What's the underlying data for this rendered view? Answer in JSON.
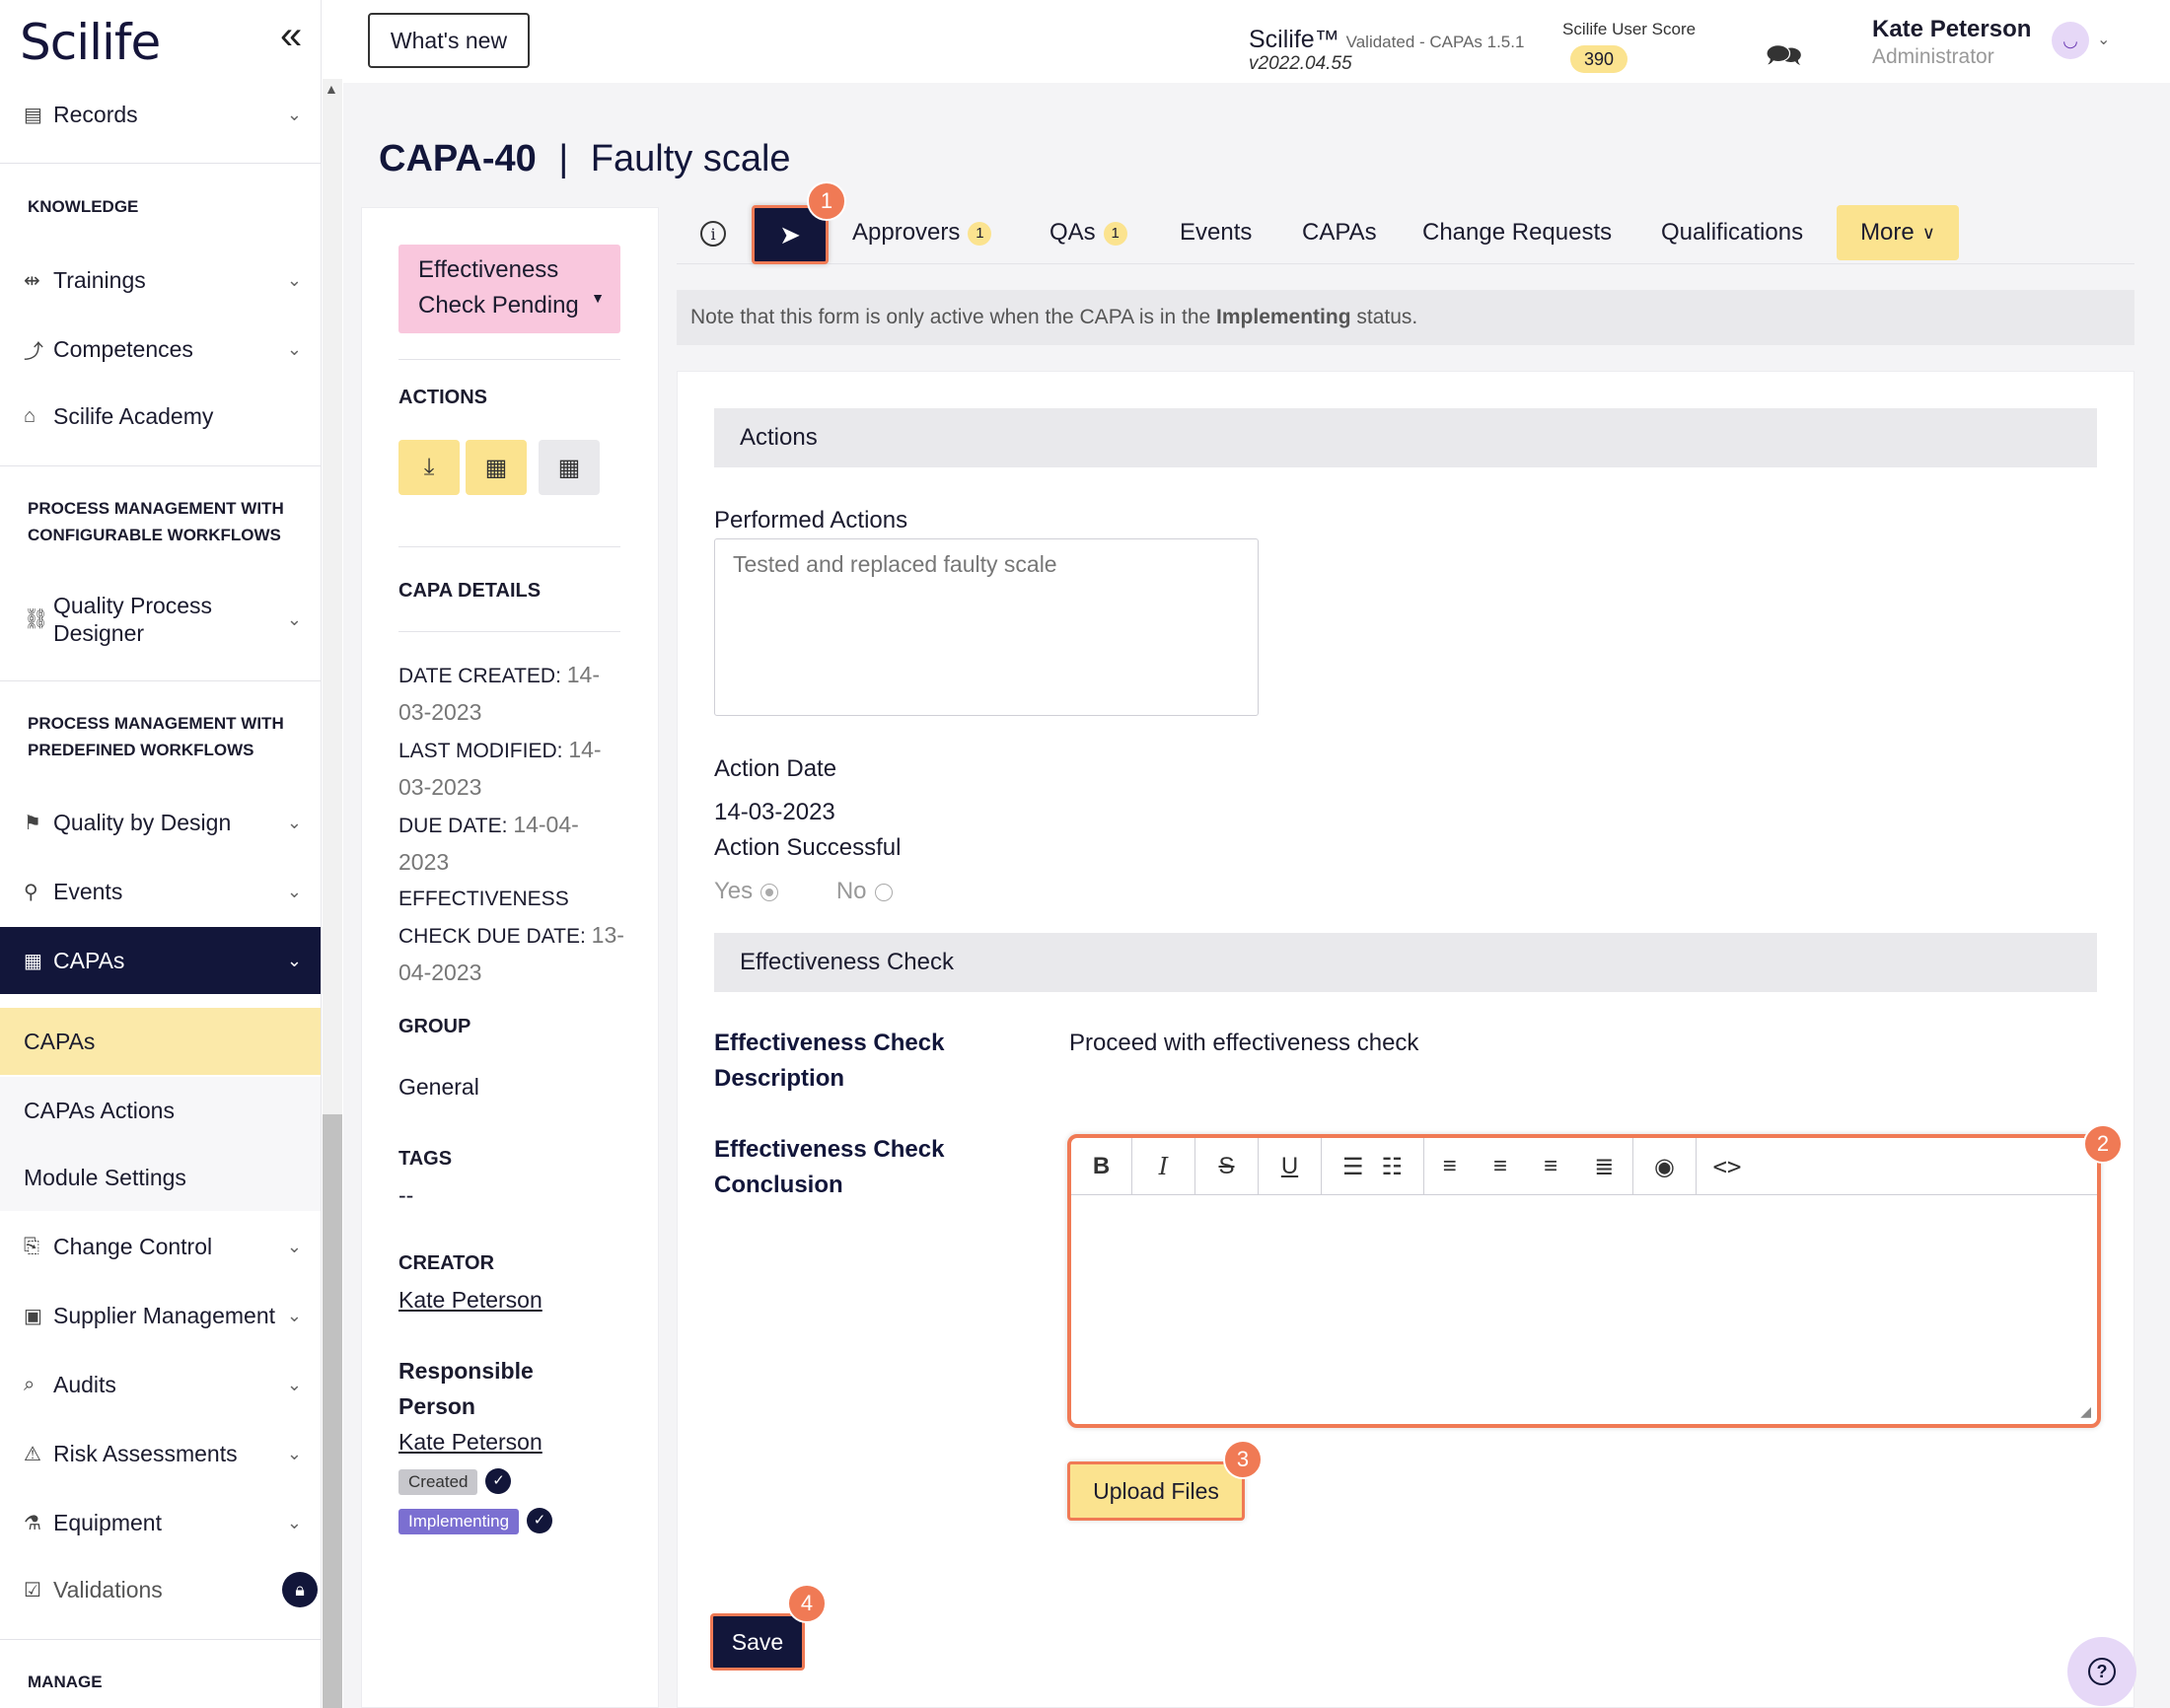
{
  "app": {
    "logo": "Scilife",
    "collapse_icon": "double-chevron-left-icon"
  },
  "sidebar": {
    "records": "Records",
    "knowledge_header": "KNOWLEDGE",
    "trainings": "Trainings",
    "competences": "Competences",
    "academy": "Scilife Academy",
    "pm_configurable_header_1": "PROCESS MANAGEMENT WITH",
    "pm_configurable_header_2": "CONFIGURABLE WORKFLOWS",
    "qpd_1": "Quality Process",
    "qpd_2": "Designer",
    "pm_predefined_header_1": "PROCESS MANAGEMENT WITH",
    "pm_predefined_header_2": "PREDEFINED WORKFLOWS",
    "qbd": "Quality by Design",
    "events": "Events",
    "capas": "CAPAs",
    "sub_capas": "CAPAs",
    "sub_capas_actions": "CAPAs Actions",
    "sub_module_settings": "Module Settings",
    "change_control": "Change Control",
    "supplier": "Supplier Management",
    "audits": "Audits",
    "risk": "Risk Assessments",
    "equipment": "Equipment",
    "validations": "Validations",
    "manage_header": "MANAGE"
  },
  "topbar": {
    "whats_new": "What's new",
    "product": "Scilife™",
    "validated": "Validated - CAPAs 1.5.1",
    "version": "v2022.04.55",
    "score_label": "Scilife User Score",
    "score_value": "390",
    "user_name": "Kate Peterson",
    "user_role": "Administrator"
  },
  "page": {
    "id": "CAPA-40",
    "separator": "|",
    "name": "Faulty scale"
  },
  "details": {
    "status_1": "Effectiveness",
    "status_2": "Check Pending",
    "actions_h": "ACTIONS",
    "capa_details_h": "CAPA DETAILS",
    "date_created_k": "DATE CREATED:",
    "date_created_v1": "14-",
    "date_created_v2": "03-2023",
    "last_modified_k": "LAST MODIFIED:",
    "last_modified_v1": "14-",
    "last_modified_v2": "03-2023",
    "due_date_k": "DUE DATE:",
    "due_date_v1": "14-04-",
    "due_date_v2": "2023",
    "eff_due_k1": "EFFECTIVENESS",
    "eff_due_k2": "CHECK DUE DATE:",
    "eff_due_v1": "13-",
    "eff_due_v2": "04-2023",
    "group_h": "GROUP",
    "group_v": "General",
    "tags_h": "TAGS",
    "tags_v": "--",
    "creator_h": "CREATOR",
    "creator_v": "Kate Peterson",
    "resp_h1": "Responsible",
    "resp_h2": "Person",
    "resp_v": "Kate Peterson",
    "tag_created": "Created",
    "tag_implementing": "Implementing"
  },
  "tabs": {
    "approvers": "Approvers",
    "approvers_count": "1",
    "qas": "QAs",
    "qas_count": "1",
    "events": "Events",
    "capas": "CAPAs",
    "change_requests": "Change Requests",
    "qualifications": "Qualifications",
    "more": "More"
  },
  "note": {
    "pre": "Note that this form is only active when the CAPA is in the ",
    "bold": "Implementing",
    "post": " status."
  },
  "form": {
    "actions_section": "Actions",
    "performed_actions_label": "Performed Actions",
    "performed_actions_value": "Tested and replaced faulty scale",
    "action_date_label": "Action Date",
    "action_date_value": "14-03-2023",
    "action_successful_label": "Action Successful",
    "yes": "Yes",
    "no": "No",
    "eff_section": "Effectiveness Check",
    "eff_desc_label_1": "Effectiveness Check",
    "eff_desc_label_2": "Description",
    "eff_desc_value": "Proceed with effectiveness check",
    "eff_concl_label_1": "Effectiveness Check",
    "eff_concl_label_2": "Conclusion",
    "upload": "Upload Files",
    "save": "Save"
  },
  "steps": [
    "1",
    "2",
    "3",
    "4"
  ],
  "colors": {
    "navy": "#12163a",
    "yellow": "#fbe38f",
    "pink": "#f9c7dd",
    "highlight": "#f07a55",
    "selected_sub": "#fbe9a9"
  }
}
